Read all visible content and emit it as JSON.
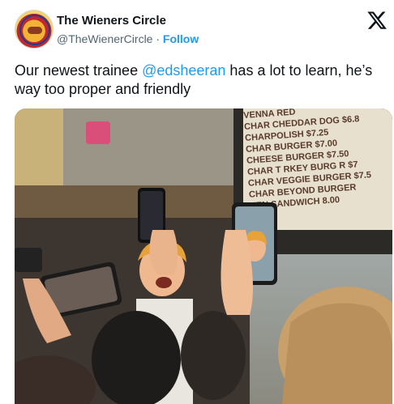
{
  "account": {
    "display_name": "The Wieners Circle",
    "handle": "@TheWienerCircle",
    "separator": "·",
    "follow_label": "Follow",
    "avatar_icon": "wieners-circle-logo"
  },
  "tweet": {
    "text_before": "Our newest trainee ",
    "mention": "@edsheeran",
    "text_after": " has a lot to learn, he’s way too proper and friendly"
  },
  "menu_sign": {
    "lines": [
      "VENNA RED",
      "CHAR CHEDDAR DOG $6.8",
      "CHARPOLISH $7.25",
      "CHAR BURGER $7.00",
      "CHEESE BURGER $7.50",
      "CHAR T RKEY BURG R $7",
      "CHAR VEGGIE BURGER $7.5",
      "CHAR BEYOND BURGER",
      "KEN SANDWICH 8.00"
    ]
  },
  "icons": {
    "platform": "x-logo-icon"
  },
  "colors": {
    "link": "#1d9bf0",
    "text": "#0f1419",
    "secondary": "#536471"
  }
}
